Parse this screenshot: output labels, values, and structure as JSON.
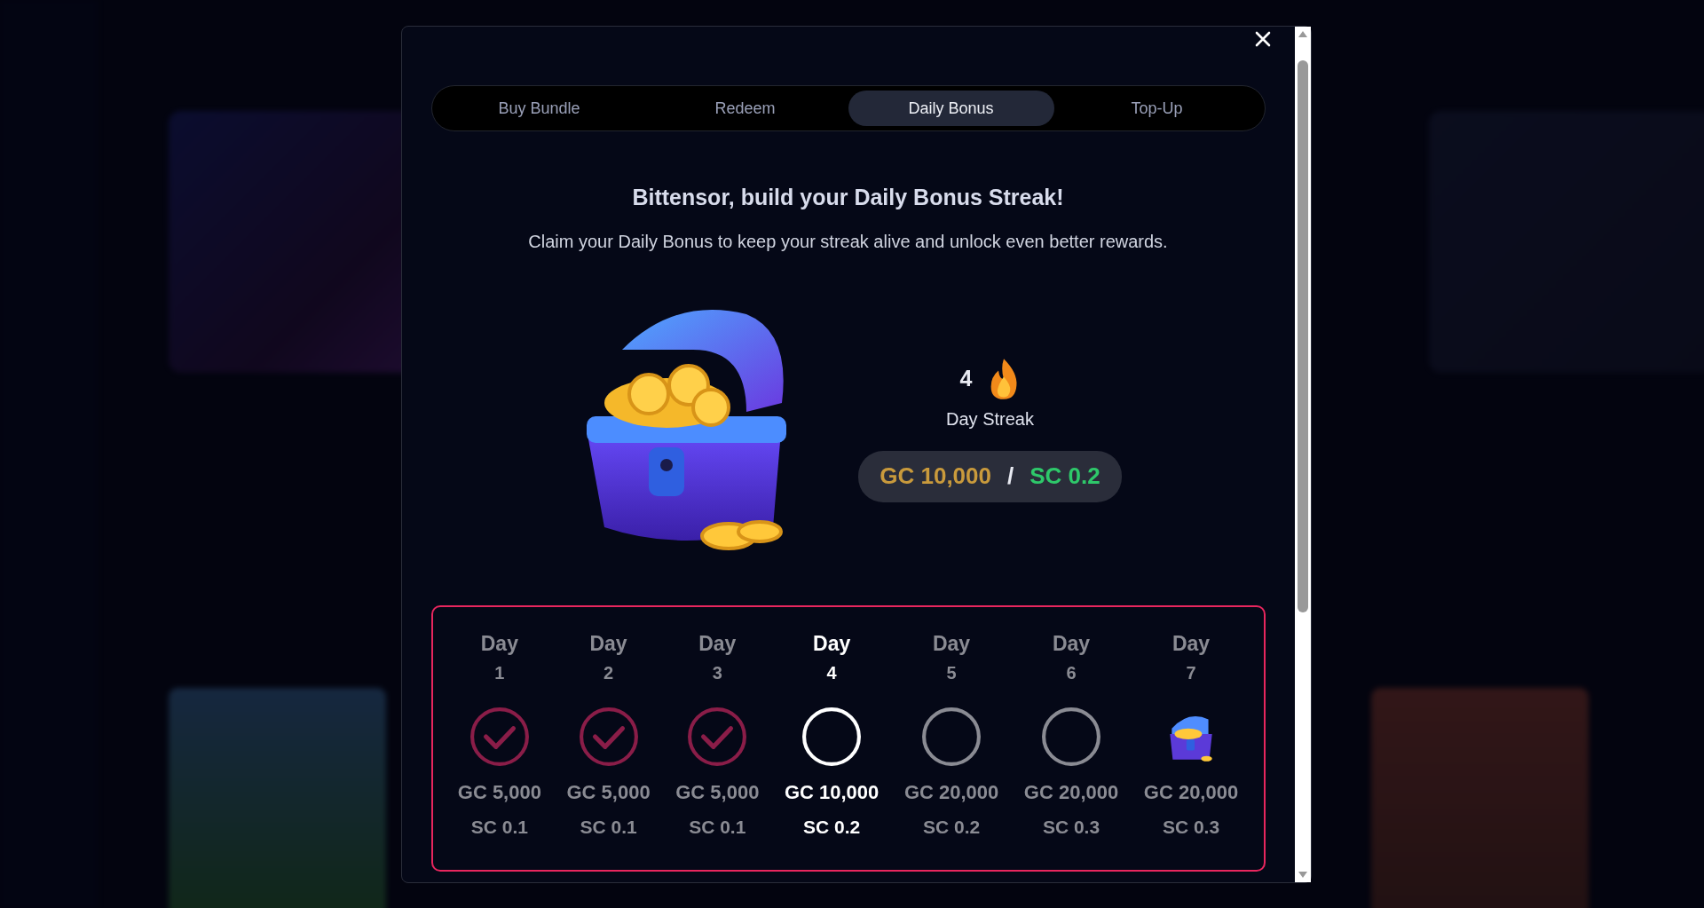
{
  "tabs": [
    {
      "label": "Buy Bundle",
      "selected": false
    },
    {
      "label": "Redeem",
      "selected": false
    },
    {
      "label": "Daily Bonus",
      "selected": true
    },
    {
      "label": "Top-Up",
      "selected": false
    }
  ],
  "heading": "Bittensor, build your Daily Bonus Streak!",
  "subheading": "Claim your Daily Bonus to keep your streak alive and unlock even better rewards.",
  "streak": {
    "count": "4",
    "label": "Day Streak",
    "gc": "GC 10,000",
    "separator": "/",
    "sc": "SC 0.2"
  },
  "days": [
    {
      "label": "Day",
      "number": "1",
      "kind": "claimed",
      "gc": "GC 5,000",
      "sc": "SC 0.1"
    },
    {
      "label": "Day",
      "number": "2",
      "kind": "claimed",
      "gc": "GC 5,000",
      "sc": "SC 0.1"
    },
    {
      "label": "Day",
      "number": "3",
      "kind": "claimed",
      "gc": "GC 5,000",
      "sc": "SC 0.1"
    },
    {
      "label": "Day",
      "number": "4",
      "kind": "current",
      "gc": "GC 10,000",
      "sc": "SC 0.2"
    },
    {
      "label": "Day",
      "number": "5",
      "kind": "upcoming",
      "gc": "GC 20,000",
      "sc": "SC 0.2"
    },
    {
      "label": "Day",
      "number": "6",
      "kind": "upcoming",
      "gc": "GC 20,000",
      "sc": "SC 0.3"
    },
    {
      "label": "Day",
      "number": "7",
      "kind": "reward",
      "gc": "GC 20,000",
      "sc": "SC 0.3"
    }
  ]
}
